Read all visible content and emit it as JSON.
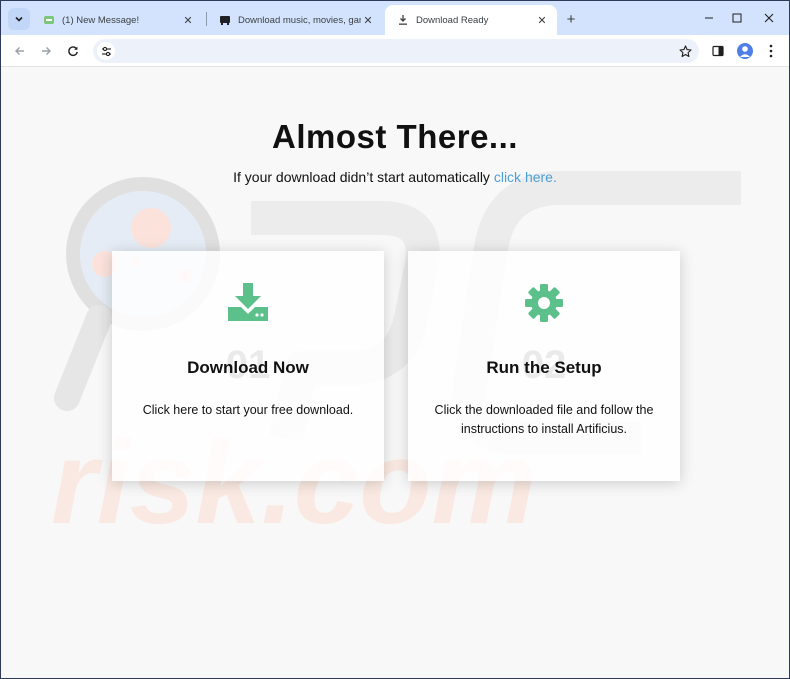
{
  "browser": {
    "tabs": [
      {
        "title": "(1) New Message!",
        "favicon": "ad-favicon"
      },
      {
        "title": "Download music, movies, games",
        "favicon": "media-favicon"
      },
      {
        "title": "Download Ready",
        "favicon": "download-favicon",
        "active": true
      }
    ],
    "new_tab": "+",
    "window_controls": {
      "minimize": "—",
      "maximize": "☐",
      "close": "✕"
    },
    "address": ""
  },
  "page": {
    "heading": "Almost There...",
    "subline_text": "If your download didn’t start automatically ",
    "subline_link": "click here.",
    "cards": [
      {
        "number": "01",
        "title": "Download Now",
        "desc": "Click here to start your free download.",
        "icon": "download-icon"
      },
      {
        "number": "02",
        "title": "Run the Setup",
        "desc": "Click the downloaded file and follow the instructions to install Artificius.",
        "icon": "gear-icon"
      }
    ],
    "watermark_text": "risk.com"
  },
  "colors": {
    "accent_green": "#5cc08a",
    "link": "#4a9fd6",
    "tabstrip": "#d3e3fd"
  }
}
